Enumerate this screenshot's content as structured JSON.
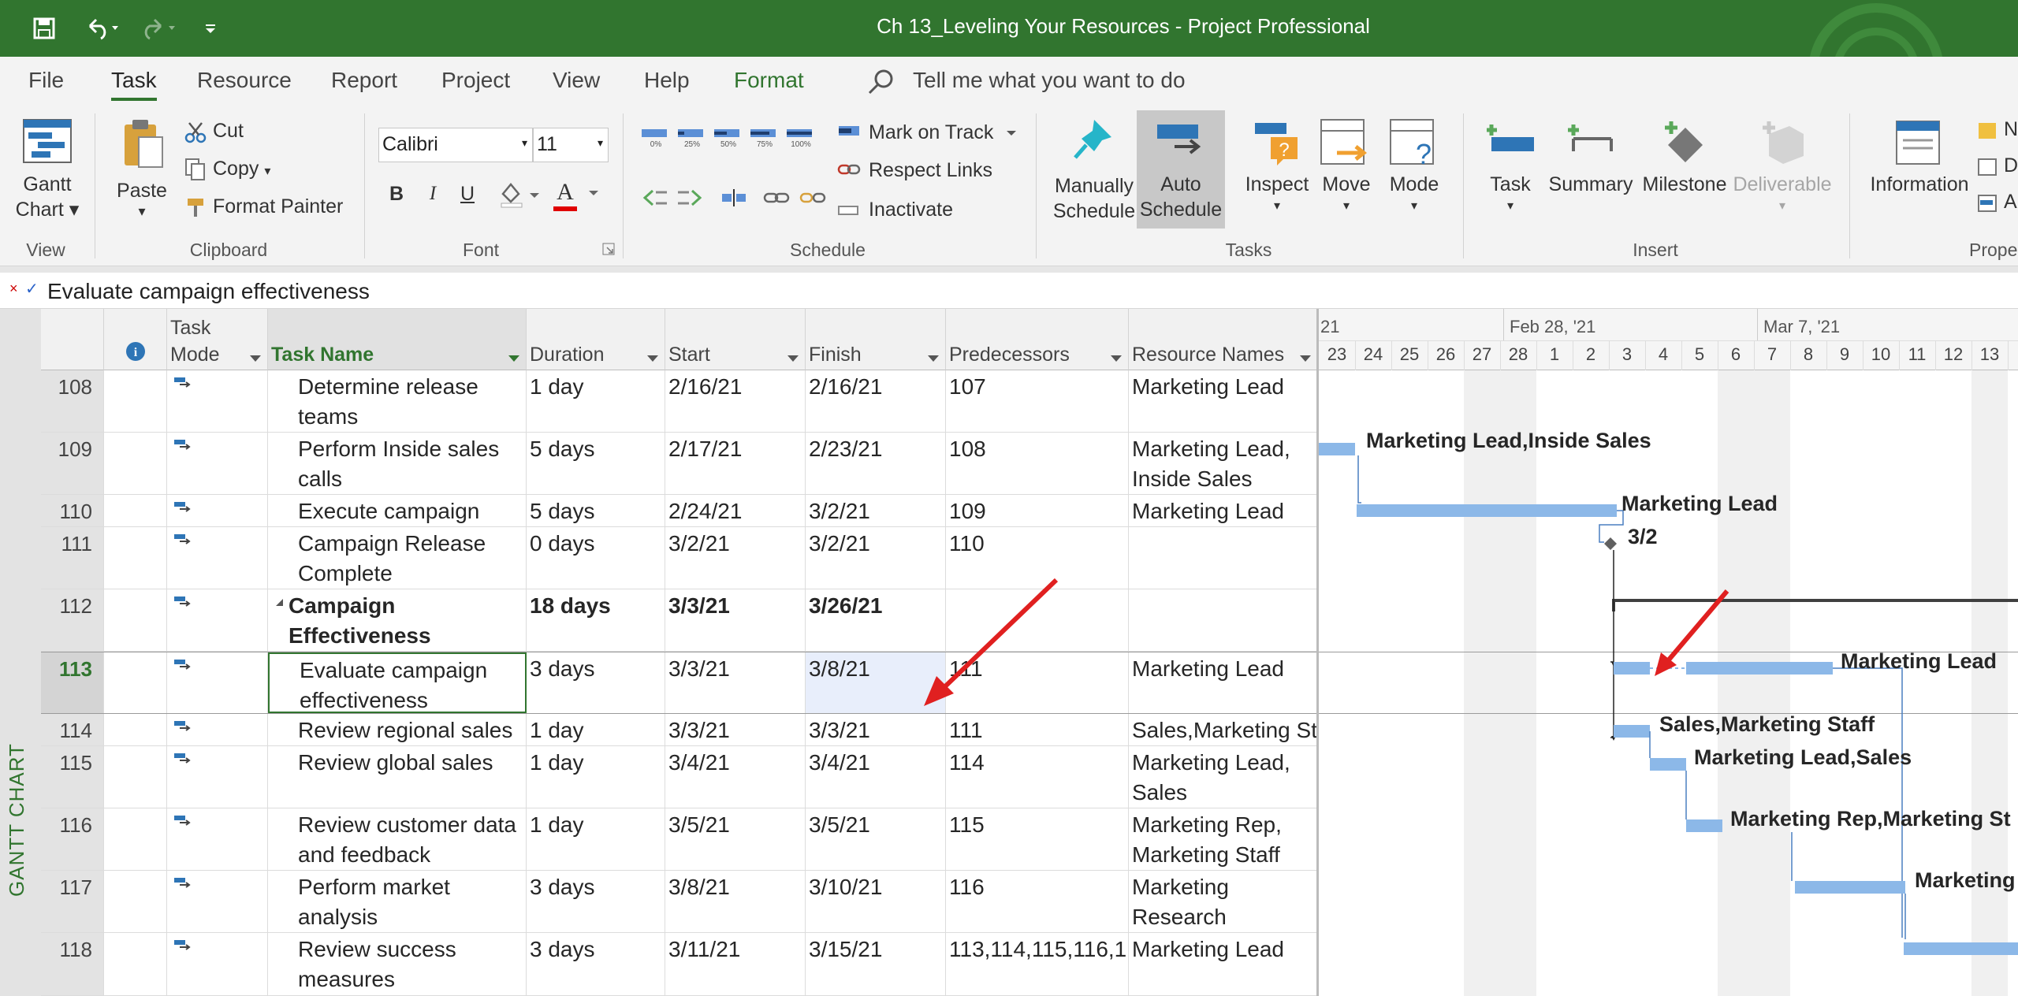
{
  "app": {
    "title": "Ch 13_Leveling Your Resources  -  Project Professional",
    "accent_color": "#31752f",
    "qat_icons": [
      "save-icon",
      "undo-icon",
      "redo-icon",
      "customize-qat-icon"
    ]
  },
  "menu": {
    "tabs": [
      "File",
      "Task",
      "Resource",
      "Report",
      "Project",
      "View",
      "Help",
      "Format"
    ],
    "active_tab": "Task",
    "tell_me": "Tell me what you want to do"
  },
  "ribbon": {
    "view": {
      "label": "View",
      "gantt_chart": "Gantt",
      "gantt_chart_2": "Chart"
    },
    "clipboard": {
      "label": "Clipboard",
      "paste": "Paste",
      "cut": "Cut",
      "copy": "Copy",
      "format_painter": "Format Painter"
    },
    "font": {
      "label": "Font",
      "family": "Calibri",
      "size": "11",
      "bold": "B",
      "italic": "I",
      "underline": "U",
      "font_color": "A"
    },
    "schedule": {
      "label": "Schedule",
      "pct_labels": [
        "0%",
        "25%",
        "50%",
        "75%",
        "100%"
      ],
      "mark_on_track": "Mark on Track",
      "respect_links": "Respect Links",
      "inactivate": "Inactivate"
    },
    "tasks": {
      "label": "Tasks",
      "manually_schedule": [
        "Manually",
        "Schedule"
      ],
      "auto_schedule": [
        "Auto",
        "Schedule"
      ],
      "inspect": "Inspect",
      "move": "Move",
      "mode": "Mode"
    },
    "insert": {
      "label": "Insert",
      "task": "Task",
      "summary": "Summary",
      "milestone": "Milestone",
      "deliverable": "Deliverable"
    },
    "properties": {
      "label": "Prope",
      "information": "Information",
      "extra": [
        "N",
        "D",
        "A"
      ]
    }
  },
  "formula_bar": {
    "value": "Evaluate campaign effectiveness"
  },
  "view_label": "GANTT CHART",
  "table": {
    "headers": {
      "info": "i",
      "task_mode": [
        "Task",
        "Mode"
      ],
      "task_name": "Task Name",
      "duration": "Duration",
      "start": "Start",
      "finish": "Finish",
      "predecessors": "Predecessors",
      "resource_names": "Resource Names"
    },
    "rows": [
      {
        "id": "108",
        "name": [
          "Determine release",
          "teams"
        ],
        "duration": "1 day",
        "start": "2/16/21",
        "finish": "2/16/21",
        "pred": "107",
        "res": [
          "Marketing Lead"
        ]
      },
      {
        "id": "109",
        "name": [
          "Perform Inside sales",
          "calls"
        ],
        "duration": "5 days",
        "start": "2/17/21",
        "finish": "2/23/21",
        "pred": "108",
        "res": [
          "Marketing Lead,",
          "Inside Sales"
        ]
      },
      {
        "id": "110",
        "name": [
          "Execute campaign"
        ],
        "duration": "5 days",
        "start": "2/24/21",
        "finish": "3/2/21",
        "pred": "109",
        "res": [
          "Marketing Lead"
        ]
      },
      {
        "id": "111",
        "name": [
          "Campaign Release",
          "Complete"
        ],
        "duration": "0 days",
        "start": "3/2/21",
        "finish": "3/2/21",
        "pred": "110",
        "res": [
          ""
        ]
      },
      {
        "id": "112",
        "name": [
          "Campaign",
          "Effectiveness"
        ],
        "duration": "18 days",
        "start": "3/3/21",
        "finish": "3/26/21",
        "pred": "",
        "res": [
          ""
        ],
        "summary": true
      },
      {
        "id": "113",
        "name": [
          "Evaluate campaign",
          "effectiveness"
        ],
        "duration": "3 days",
        "start": "3/3/21",
        "finish": "3/8/21",
        "pred": "111",
        "res": [
          "Marketing Lead"
        ],
        "selected": true
      },
      {
        "id": "114",
        "name": [
          "Review regional sales"
        ],
        "duration": "1 day",
        "start": "3/3/21",
        "finish": "3/3/21",
        "pred": "111",
        "res": [
          "Sales,Marketing St"
        ]
      },
      {
        "id": "115",
        "name": [
          "Review global sales"
        ],
        "duration": "1 day",
        "start": "3/4/21",
        "finish": "3/4/21",
        "pred": "114",
        "res": [
          "Marketing Lead,",
          "Sales"
        ]
      },
      {
        "id": "116",
        "name": [
          "Review customer data",
          "and feedback"
        ],
        "duration": "1 day",
        "start": "3/5/21",
        "finish": "3/5/21",
        "pred": "115",
        "res": [
          "Marketing Rep,",
          "Marketing Staff"
        ]
      },
      {
        "id": "117",
        "name": [
          "Perform market",
          "analysis"
        ],
        "duration": "3 days",
        "start": "3/8/21",
        "finish": "3/10/21",
        "pred": "116",
        "res": [
          "Marketing",
          "Research"
        ]
      },
      {
        "id": "118",
        "name": [
          "Review success",
          "measures"
        ],
        "duration": "3 days",
        "start": "3/11/21",
        "finish": "3/15/21",
        "pred": "113,114,115,116,1",
        "res": [
          "Marketing Lead"
        ]
      }
    ]
  },
  "gantt": {
    "timescale_top": [
      "21",
      "Feb 28, '21",
      "Mar 7, '21"
    ],
    "timescale_days": [
      "23",
      "24",
      "25",
      "26",
      "27",
      "28",
      "1",
      "2",
      "3",
      "4",
      "5",
      "6",
      "7",
      "8",
      "9",
      "10",
      "11",
      "12",
      "13"
    ],
    "bar_color": "#8cb8e8",
    "bar_labels": {
      "r109": "Marketing Lead,Inside Sales",
      "r110": "Marketing Lead",
      "r111": "3/2",
      "r113": "Marketing Lead",
      "r114": "Sales,Marketing Staff",
      "r115": "Marketing Lead,Sales",
      "r116": "Marketing Rep,Marketing St",
      "r117": "Marketing"
    }
  }
}
